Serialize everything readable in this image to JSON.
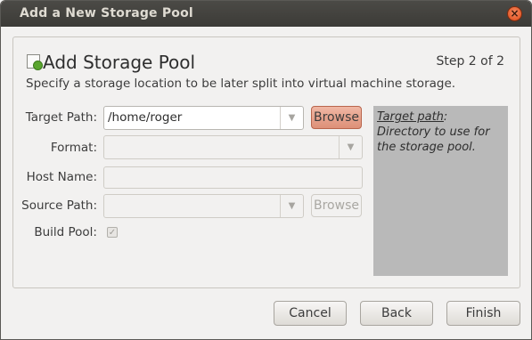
{
  "window": {
    "title": "Add a New Storage Pool",
    "close_glyph": "×"
  },
  "header": {
    "icon": "storage-pool-add-icon",
    "title": "Add Storage Pool",
    "step": "Step 2 of 2",
    "subtitle": "Specify a storage location to be later split into virtual machine storage."
  },
  "form": {
    "target_path": {
      "label": "Target Path:",
      "value": "/home/roger",
      "browse_label": "Browse"
    },
    "format": {
      "label": "Format:",
      "value": ""
    },
    "host_name": {
      "label": "Host Name:",
      "value": ""
    },
    "source_path": {
      "label": "Source Path:",
      "value": "",
      "browse_label": "Browse"
    },
    "build_pool": {
      "label": "Build Pool:",
      "checked": true
    }
  },
  "help": {
    "term": "Target path",
    "text": ": Directory to use for the storage pool."
  },
  "footer": {
    "cancel_label": "Cancel",
    "back_label": "Back",
    "finish_label": "Finish"
  },
  "colors": {
    "titlebar": "#3c3b37",
    "accent_button": "#dd9078",
    "close_button": "#df4a16",
    "help_background": "#b9b9b9"
  }
}
